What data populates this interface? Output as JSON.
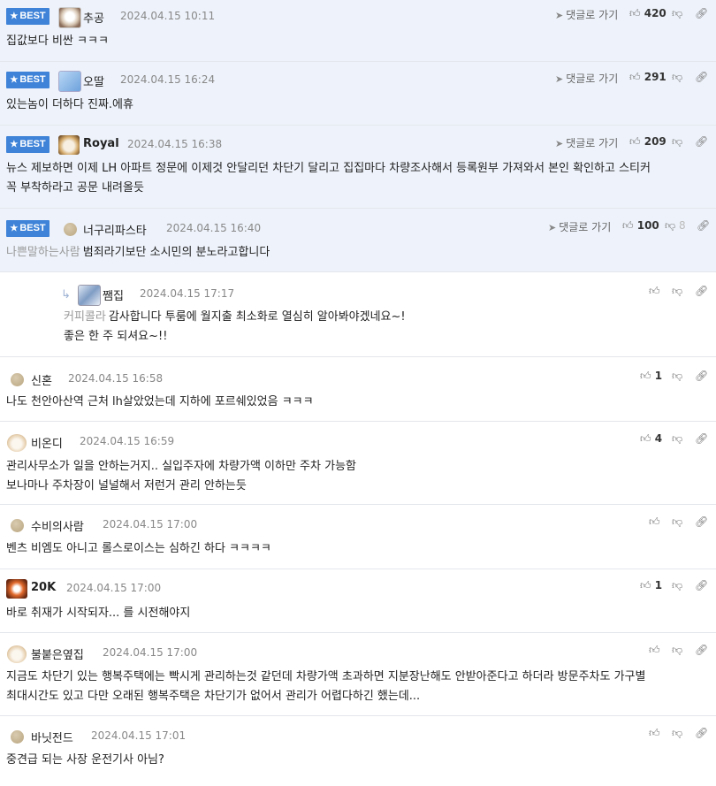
{
  "labels": {
    "best": "BEST",
    "reply": "댓글로 가기"
  },
  "comments": [
    {
      "nick": "추공",
      "date": "2024.04.15 10:11",
      "likes": "420",
      "text1": "집값보다 비싼 ㅋㅋㅋ"
    },
    {
      "nick": "오딸",
      "date": "2024.04.15 16:24",
      "likes": "291",
      "text1": "있는놈이 더하다 진짜.에휴"
    },
    {
      "nick": "Royal",
      "date": "2024.04.15 16:38",
      "likes": "209",
      "text1": "뉴스 제보하면 이제 LH 아파트 정문에 이제것 안달리던 차단기 달리고 집집마다 차량조사해서 등록원부 가져와서 본인 확인하고 스티커",
      "text2": "꼭 부착하라고 공문 내려올듯"
    },
    {
      "nick": "너구리파스타",
      "date": "2024.04.15 16:40",
      "likes": "100",
      "dislikes": "8",
      "mention": "나쁜말하는사람",
      "text1": "범죄라기보단 소시민의 분노라고합니다"
    },
    {
      "nick": "쨈집",
      "date": "2024.04.15 17:17",
      "mention": "커피콜라",
      "text1": "감사합니다 투룸에 월지출 최소화로 열심히 알아봐야겠네요~!",
      "text2": "좋은 한 주 되셔요~!!"
    },
    {
      "nick": "신혼",
      "date": "2024.04.15 16:58",
      "likes": "1",
      "text1": "나도 천안아산역 근처 lh살았었는데 지하에 포르쉐있었음 ㅋㅋㅋ"
    },
    {
      "nick": "비온디",
      "date": "2024.04.15 16:59",
      "likes": "4",
      "text1": "관리사무소가 일을 안하는거지.. 실입주자에 차량가액 이하만 주차 가능함",
      "text2": "보나마나 주차장이 널널해서 저런거 관리 안하는듯"
    },
    {
      "nick": "수비의사람",
      "date": "2024.04.15 17:00",
      "text1": "벤츠 비엠도 아니고 롤스로이스는 심하긴 하다 ㅋㅋㅋㅋ"
    },
    {
      "nick": "20K",
      "date": "2024.04.15 17:00",
      "likes": "1",
      "text1": "바로 취재가 시작되자... 를 시전해야지"
    },
    {
      "nick": "불붙은옆집",
      "date": "2024.04.15 17:00",
      "text1": "지금도 차단기 있는 행복주택에는 빡시게 관리하는것 같던데 차량가액 초과하면 지분장난해도 안받아준다고 하더라 방문주차도 가구별",
      "text2": "최대시간도 있고 다만 오래된 행복주택은 차단기가 없어서 관리가 어렵다하긴 했는데..."
    },
    {
      "nick": "바닛전드",
      "date": "2024.04.15 17:01",
      "text1": "중견급 되는 사장 운전기사 아님?"
    }
  ]
}
